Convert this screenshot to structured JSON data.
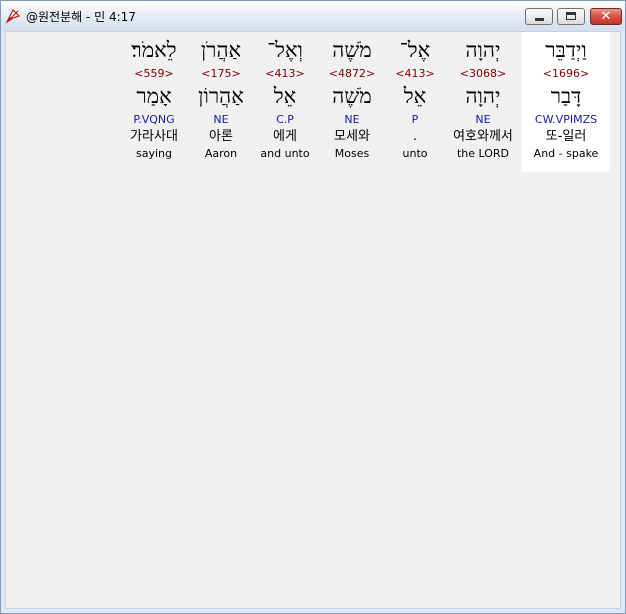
{
  "window": {
    "title": "@원전분해 - 민 4:17",
    "close_glyph": "✕"
  },
  "words": [
    {
      "hebrew": "וַיְדַבֵּר",
      "strong": "<1696>",
      "root": "דָּבַר",
      "morph": "CW.VPIMZS",
      "korean": "또-일러",
      "english": "And - spake",
      "selected": true
    },
    {
      "hebrew": "יְהוָה",
      "strong": "<3068>",
      "root": "יְהוָה",
      "morph": "NE",
      "korean": "여호와께서",
      "english": "the LORD",
      "selected": false
    },
    {
      "hebrew": "אֶל־",
      "strong": "<413>",
      "root": "אֵל",
      "morph": "P",
      "korean": ".",
      "english": "unto",
      "selected": false
    },
    {
      "hebrew": "מֹשֶׁה",
      "strong": "<4872>",
      "root": "מֹשֶׁה",
      "morph": "NE",
      "korean": "모세와",
      "english": "Moses",
      "selected": false
    },
    {
      "hebrew": "וְאֶל־",
      "strong": "<413>",
      "root": "אֵל",
      "morph": "C.P",
      "korean": "에게",
      "english": "and unto",
      "selected": false
    },
    {
      "hebrew": "אַהֲרֹן",
      "strong": "<175>",
      "root": "אַהֲרוֹן",
      "morph": "NE",
      "korean": "아론",
      "english": "Aaron",
      "selected": false
    },
    {
      "hebrew": "לֵאמֹר׃",
      "strong": "<559>",
      "root": "אָמַר",
      "morph": "P.VQNG",
      "korean": "가라사대",
      "english": "saying",
      "selected": false
    }
  ]
}
